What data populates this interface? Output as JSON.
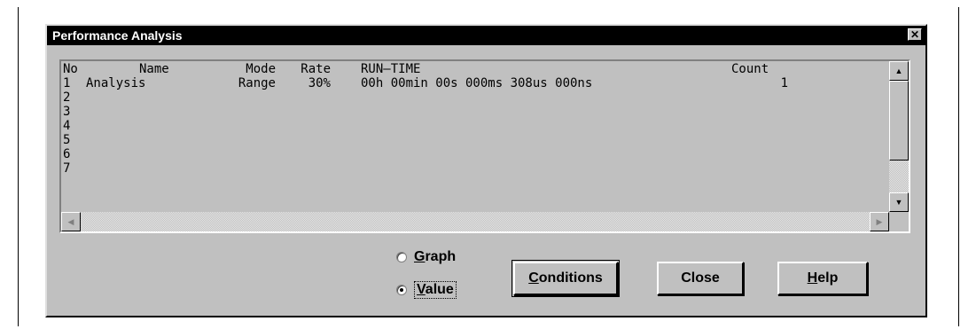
{
  "window": {
    "title": "Performance Analysis",
    "close_glyph": "✕"
  },
  "table": {
    "headers": {
      "no": "No",
      "name": "Name",
      "mode": "Mode",
      "rate": "Rate",
      "runtime": "RUN–TIME",
      "count": "Count"
    },
    "rows": [
      {
        "no": "1",
        "name": "Analysis",
        "mode": "Range",
        "rate": "30%",
        "runtime": "00h 00min 00s 000ms 308us 000ns",
        "count": "1"
      },
      {
        "no": "2",
        "name": "",
        "mode": "",
        "rate": "",
        "runtime": "",
        "count": ""
      },
      {
        "no": "3",
        "name": "",
        "mode": "",
        "rate": "",
        "runtime": "",
        "count": ""
      },
      {
        "no": "4",
        "name": "",
        "mode": "",
        "rate": "",
        "runtime": "",
        "count": ""
      },
      {
        "no": "5",
        "name": "",
        "mode": "",
        "rate": "",
        "runtime": "",
        "count": ""
      },
      {
        "no": "6",
        "name": "",
        "mode": "",
        "rate": "",
        "runtime": "",
        "count": ""
      },
      {
        "no": "7",
        "name": "",
        "mode": "",
        "rate": "",
        "runtime": "",
        "count": ""
      }
    ]
  },
  "scroll": {
    "up_glyph": "▲",
    "down_glyph": "▼",
    "left_glyph": "◀",
    "right_glyph": "▶"
  },
  "display_mode": {
    "graph": {
      "key": "G",
      "rest": "raph",
      "selected": false
    },
    "value": {
      "key": "V",
      "rest": "alue",
      "selected": true
    }
  },
  "buttons": {
    "conditions": {
      "key": "C",
      "rest": "onditions"
    },
    "close": {
      "label": "Close"
    },
    "help": {
      "key": "H",
      "rest": "elp"
    }
  }
}
